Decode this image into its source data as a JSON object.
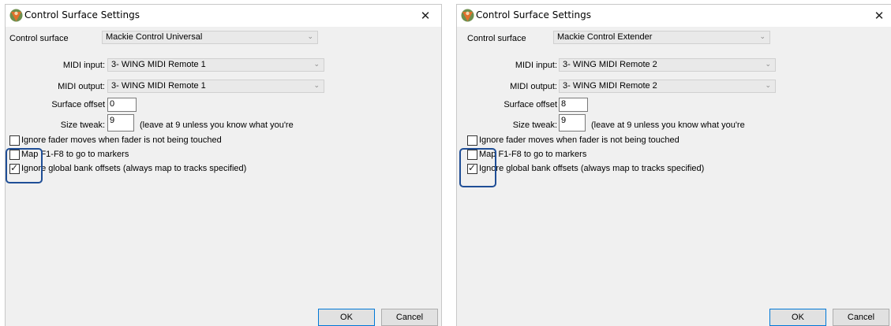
{
  "dialogs": [
    {
      "title": "Control Surface Settings",
      "close_glyph": "✕",
      "surface_label": "Control surface",
      "surface_value": "Mackie Control Universal",
      "midi_input_label": "MIDI input:",
      "midi_input_value": "3- WING MIDI Remote 1",
      "midi_output_label": "MIDI output:",
      "midi_output_value": "3- WING MIDI Remote 1",
      "offset_label": "Surface offset",
      "offset_value": "0",
      "size_label": "Size tweak:",
      "size_value": "9",
      "size_hint": "(leave at 9 unless you know what you're",
      "checkboxes": [
        {
          "label": "Ignore fader moves when fader is not being touched",
          "checked": false
        },
        {
          "label": "Map F1-F8 to go to markers",
          "checked": false
        },
        {
          "label": "Ignore global bank offsets (always map to tracks specified)",
          "checked": true
        }
      ],
      "ok_label": "OK",
      "cancel_label": "Cancel"
    },
    {
      "title": "Control Surface Settings",
      "close_glyph": "✕",
      "surface_label": "Control surface",
      "surface_value": "Mackie Control Extender",
      "midi_input_label": "MIDI input:",
      "midi_input_value": "3- WING MIDI Remote 2",
      "midi_output_label": "MIDI output:",
      "midi_output_value": "3- WING MIDI Remote 2",
      "offset_label": "Surface offset",
      "offset_value": "8",
      "size_label": "Size tweak:",
      "size_value": "9",
      "size_hint": "(leave at 9 unless you know what you're",
      "checkboxes": [
        {
          "label": "Ignore fader moves when fader is not being touched",
          "checked": false
        },
        {
          "label": "Map F1-F8 to go to markers",
          "checked": false
        },
        {
          "label": "Ignore global bank offsets (always map to tracks specified)",
          "checked": true
        }
      ],
      "ok_label": "OK",
      "cancel_label": "Cancel"
    }
  ],
  "check_glyph": "✓",
  "chevron_glyph": "⌄",
  "icons": {
    "app": "reaper-logo-icon",
    "close": "close-icon",
    "dropdown": "chevron-down-icon",
    "highlight": "highlight-annotation"
  },
  "colors": {
    "highlight": "#1f4e96",
    "dialog_bg": "#f0f0f0",
    "default_button_border": "#0078d7"
  }
}
